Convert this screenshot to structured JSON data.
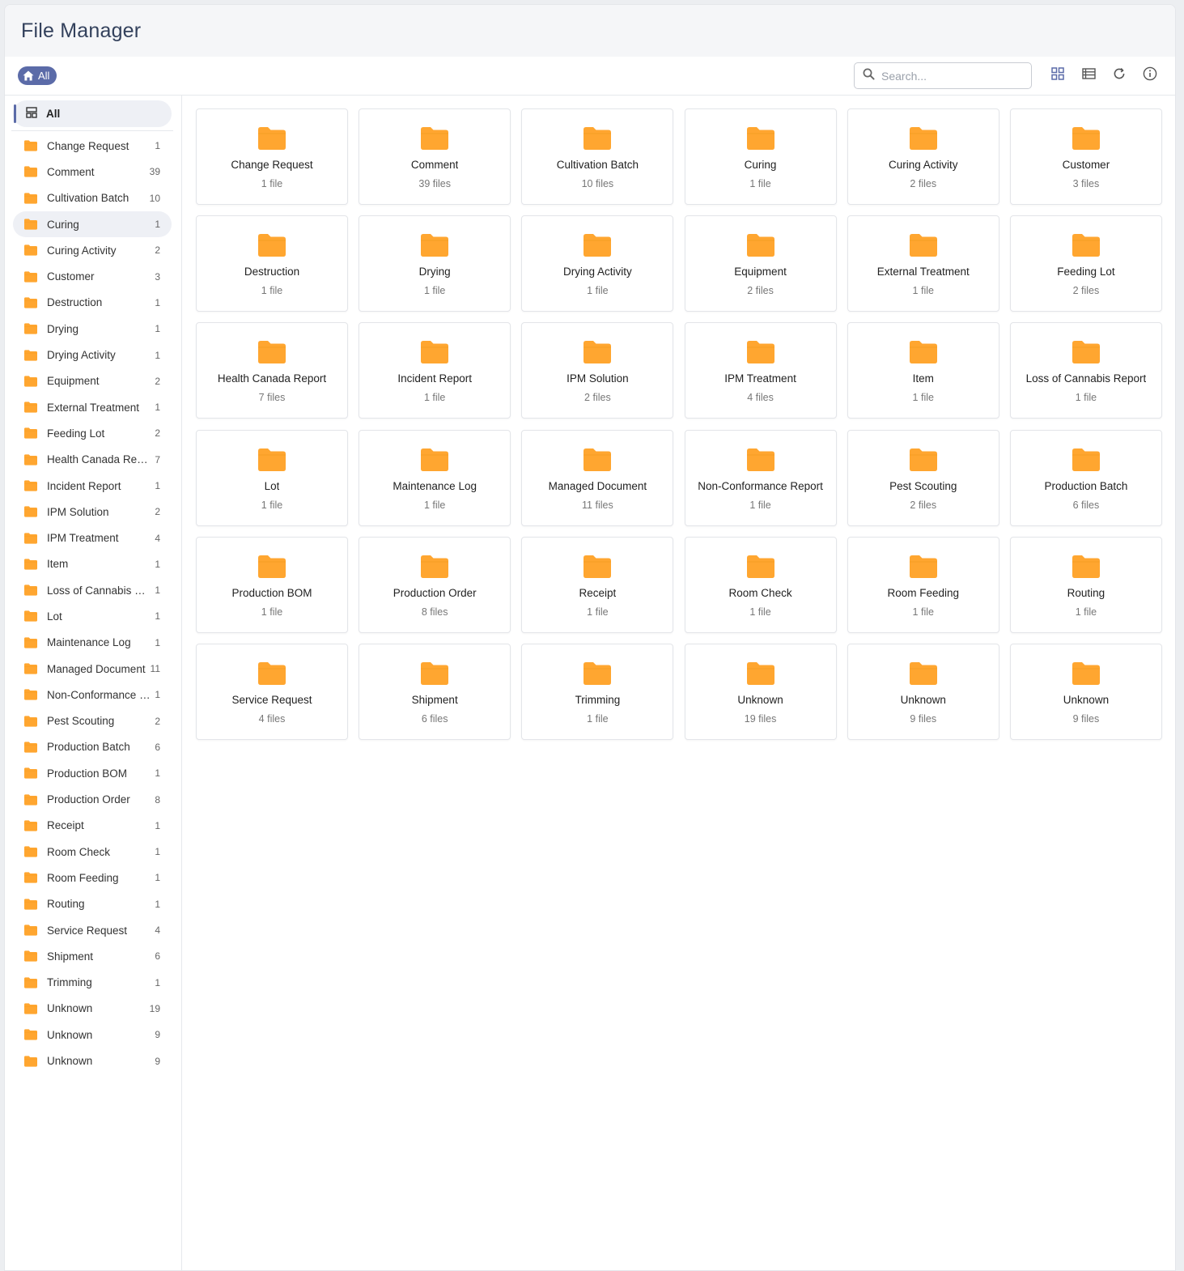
{
  "app": {
    "title": "File Manager"
  },
  "toolbar": {
    "breadcrumb_label": "All",
    "search_placeholder": "Search...",
    "icons": [
      "home-icon",
      "search-icon",
      "grid-view-icon",
      "list-view-icon",
      "refresh-icon",
      "info-icon"
    ]
  },
  "colors": {
    "accent": "#5b6ba8",
    "folder": "#ffa630"
  },
  "sidebar": {
    "all_label": "All",
    "items": [
      {
        "label": "Change Request",
        "count": "1"
      },
      {
        "label": "Comment",
        "count": "39"
      },
      {
        "label": "Cultivation Batch",
        "count": "10"
      },
      {
        "label": "Curing",
        "count": "1",
        "active": true
      },
      {
        "label": "Curing Activity",
        "count": "2"
      },
      {
        "label": "Customer",
        "count": "3"
      },
      {
        "label": "Destruction",
        "count": "1"
      },
      {
        "label": "Drying",
        "count": "1"
      },
      {
        "label": "Drying Activity",
        "count": "1"
      },
      {
        "label": "Equipment",
        "count": "2"
      },
      {
        "label": "External Treatment",
        "count": "1"
      },
      {
        "label": "Feeding Lot",
        "count": "2"
      },
      {
        "label": "Health Canada Report",
        "count": "7"
      },
      {
        "label": "Incident Report",
        "count": "1"
      },
      {
        "label": "IPM Solution",
        "count": "2"
      },
      {
        "label": "IPM Treatment",
        "count": "4"
      },
      {
        "label": "Item",
        "count": "1"
      },
      {
        "label": "Loss of Cannabis Report",
        "count": "1"
      },
      {
        "label": "Lot",
        "count": "1"
      },
      {
        "label": "Maintenance Log",
        "count": "1"
      },
      {
        "label": "Managed Document",
        "count": "11"
      },
      {
        "label": "Non-Conformance Report",
        "count": "1"
      },
      {
        "label": "Pest Scouting",
        "count": "2"
      },
      {
        "label": "Production Batch",
        "count": "6"
      },
      {
        "label": "Production BOM",
        "count": "1"
      },
      {
        "label": "Production Order",
        "count": "8"
      },
      {
        "label": "Receipt",
        "count": "1"
      },
      {
        "label": "Room Check",
        "count": "1"
      },
      {
        "label": "Room Feeding",
        "count": "1"
      },
      {
        "label": "Routing",
        "count": "1"
      },
      {
        "label": "Service Request",
        "count": "4"
      },
      {
        "label": "Shipment",
        "count": "6"
      },
      {
        "label": "Trimming",
        "count": "1"
      },
      {
        "label": "Unknown",
        "count": "19"
      },
      {
        "label": "Unknown",
        "count": "9"
      },
      {
        "label": "Unknown",
        "count": "9"
      }
    ]
  },
  "folders": [
    {
      "name": "Change Request",
      "files": "1 file"
    },
    {
      "name": "Comment",
      "files": "39 files"
    },
    {
      "name": "Cultivation Batch",
      "files": "10 files"
    },
    {
      "name": "Curing",
      "files": "1 file"
    },
    {
      "name": "Curing Activity",
      "files": "2 files"
    },
    {
      "name": "Customer",
      "files": "3 files"
    },
    {
      "name": "Destruction",
      "files": "1 file"
    },
    {
      "name": "Drying",
      "files": "1 file"
    },
    {
      "name": "Drying Activity",
      "files": "1 file"
    },
    {
      "name": "Equipment",
      "files": "2 files"
    },
    {
      "name": "External Treatment",
      "files": "1 file"
    },
    {
      "name": "Feeding Lot",
      "files": "2 files"
    },
    {
      "name": "Health Canada Report",
      "files": "7 files"
    },
    {
      "name": "Incident Report",
      "files": "1 file"
    },
    {
      "name": "IPM Solution",
      "files": "2 files"
    },
    {
      "name": "IPM Treatment",
      "files": "4 files"
    },
    {
      "name": "Item",
      "files": "1 file"
    },
    {
      "name": "Loss of Cannabis Report",
      "files": "1 file"
    },
    {
      "name": "Lot",
      "files": "1 file"
    },
    {
      "name": "Maintenance Log",
      "files": "1 file"
    },
    {
      "name": "Managed Document",
      "files": "11 files"
    },
    {
      "name": "Non-Conformance Report",
      "files": "1 file"
    },
    {
      "name": "Pest Scouting",
      "files": "2 files"
    },
    {
      "name": "Production Batch",
      "files": "6 files"
    },
    {
      "name": "Production BOM",
      "files": "1 file"
    },
    {
      "name": "Production Order",
      "files": "8 files"
    },
    {
      "name": "Receipt",
      "files": "1 file"
    },
    {
      "name": "Room Check",
      "files": "1 file"
    },
    {
      "name": "Room Feeding",
      "files": "1 file"
    },
    {
      "name": "Routing",
      "files": "1 file"
    },
    {
      "name": "Service Request",
      "files": "4 files"
    },
    {
      "name": "Shipment",
      "files": "6 files"
    },
    {
      "name": "Trimming",
      "files": "1 file"
    },
    {
      "name": "Unknown",
      "files": "19 files"
    },
    {
      "name": "Unknown",
      "files": "9 files"
    },
    {
      "name": "Unknown",
      "files": "9 files"
    }
  ]
}
